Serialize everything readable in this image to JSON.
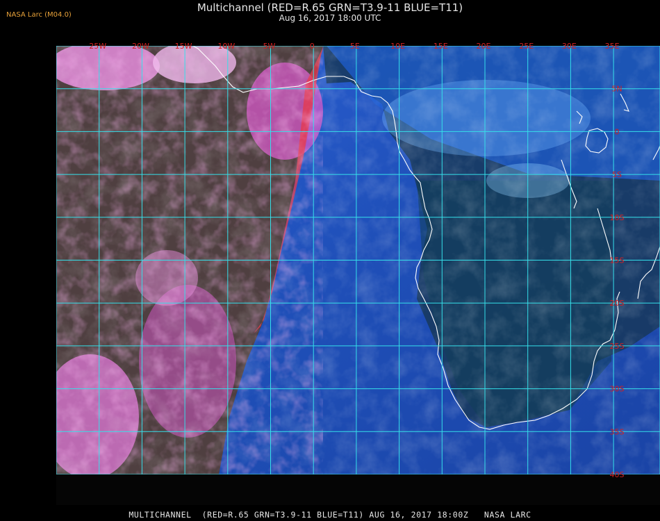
{
  "header": {
    "badge": "NASA Larc (M04.0)",
    "title": "Multichannel (RED=R.65 GRN=T3.9-11 BLUE=T11)",
    "datetime": "Aug 16, 2017 18:00 UTC"
  },
  "footer": {
    "caption": "MULTICHANNEL  (RED=R.65 GRN=T3.9-11 BLUE=T11) AUG 16, 2017 18:00Z   NASA LARC"
  },
  "grid": {
    "lon_labels": [
      "25W",
      "20W",
      "15W",
      "10W",
      "5W",
      "0",
      "5E",
      "10E",
      "15E",
      "20E",
      "25E",
      "30E",
      "35E"
    ],
    "lat_labels": [
      "5N",
      "0",
      "5S",
      "10S",
      "15S",
      "20S",
      "25S",
      "30S",
      "35S",
      "40S"
    ]
  },
  "colors": {
    "grid_line": "#35e0ea",
    "grid_label": "#d42020",
    "coastline": "#ffffff",
    "ocean_blue": "#1f4fb0",
    "cloud_magenta": "#d85cc8",
    "land_green": "#13381e"
  }
}
